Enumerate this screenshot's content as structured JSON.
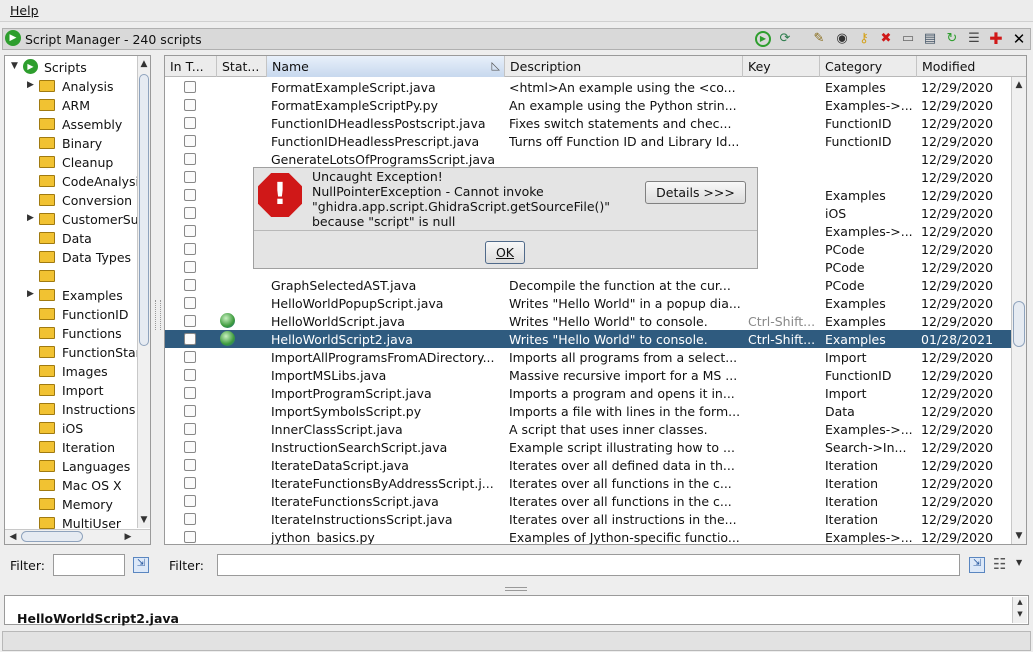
{
  "menu": {
    "help": "Help"
  },
  "title": "Script Manager - 240 scripts",
  "tree": {
    "root": "Scripts",
    "items": [
      {
        "label": "Analysis",
        "expandable": true
      },
      {
        "label": "ARM",
        "expandable": false
      },
      {
        "label": "Assembly",
        "expandable": false
      },
      {
        "label": "Binary",
        "expandable": false
      },
      {
        "label": "Cleanup",
        "expandable": false
      },
      {
        "label": "CodeAnalysis",
        "expandable": false
      },
      {
        "label": "Conversion",
        "expandable": false
      },
      {
        "label": "CustomerSubmission",
        "expandable": true
      },
      {
        "label": "Data",
        "expandable": false
      },
      {
        "label": "Data Types",
        "expandable": false
      },
      {
        "label": "",
        "expandable": false
      },
      {
        "label": "Examples",
        "expandable": true
      },
      {
        "label": "FunctionID",
        "expandable": false
      },
      {
        "label": "Functions",
        "expandable": false
      },
      {
        "label": "FunctionStartPatterns",
        "expandable": false
      },
      {
        "label": "Images",
        "expandable": false
      },
      {
        "label": "Import",
        "expandable": false
      },
      {
        "label": "Instructions",
        "expandable": false
      },
      {
        "label": "iOS",
        "expandable": false
      },
      {
        "label": "Iteration",
        "expandable": false
      },
      {
        "label": "Languages",
        "expandable": false
      },
      {
        "label": "Mac OS X",
        "expandable": false
      },
      {
        "label": "Memory",
        "expandable": false
      },
      {
        "label": "MultiUser",
        "expandable": false
      }
    ]
  },
  "filter_label": "Filter:",
  "columns": [
    "In T...",
    "Stat...",
    "Name",
    "Description",
    "Key",
    "Category",
    "Modified"
  ],
  "rows": [
    {
      "name": "FormatExampleScript.java",
      "desc": "<html>An example using the <co...",
      "key": "",
      "cat": "Examples",
      "mod": "12/29/2020",
      "status": "",
      "selected": false
    },
    {
      "name": "FormatExampleScriptPy.py",
      "desc": "An example using the Python strin...",
      "key": "",
      "cat": "Examples->...",
      "mod": "12/29/2020",
      "status": "",
      "selected": false
    },
    {
      "name": "FunctionIDHeadlessPostscript.java",
      "desc": "Fixes switch statements and chec...",
      "key": "",
      "cat": "FunctionID",
      "mod": "12/29/2020",
      "status": "",
      "selected": false
    },
    {
      "name": "FunctionIDHeadlessPrescript.java",
      "desc": "Turns off Function ID and Library Id...",
      "key": "",
      "cat": "FunctionID",
      "mod": "12/29/2020",
      "status": "",
      "selected": false
    },
    {
      "name": "GenerateLotsOfProgramsScript.java",
      "desc": "",
      "key": "",
      "cat": "",
      "mod": "12/29/2020",
      "status": "",
      "selected": false
    },
    {
      "name": "",
      "desc": "",
      "key": "",
      "cat": "",
      "mod": "12/29/2020",
      "status": "",
      "selected": false
    },
    {
      "name": "",
      "desc": "",
      "key": "",
      "cat": "Examples",
      "mod": "12/29/2020",
      "status": "",
      "selected": false
    },
    {
      "name": "",
      "desc": "",
      "key": "",
      "cat": "iOS",
      "mod": "12/29/2020",
      "status": "",
      "selected": false
    },
    {
      "name": "",
      "desc": "",
      "key": "",
      "cat": "Examples->...",
      "mod": "12/29/2020",
      "status": "",
      "selected": false
    },
    {
      "name": "",
      "desc": "",
      "key": "",
      "cat": "PCode",
      "mod": "12/29/2020",
      "status": "",
      "selected": false
    },
    {
      "name": "",
      "desc": "",
      "key": "",
      "cat": "PCode",
      "mod": "12/29/2020",
      "status": "",
      "selected": false
    },
    {
      "name": "GraphSelectedAST.java",
      "desc": "Decompile the function at the cur...",
      "key": "",
      "cat": "PCode",
      "mod": "12/29/2020",
      "status": "",
      "selected": false
    },
    {
      "name": "HelloWorldPopupScript.java",
      "desc": "Writes \"Hello World\" in a popup dia...",
      "key": "",
      "cat": "Examples",
      "mod": "12/29/2020",
      "status": "",
      "selected": false
    },
    {
      "name": "HelloWorldScript.java",
      "desc": "Writes \"Hello World\" to console.",
      "key": "Ctrl-Shift...",
      "cat": "Examples",
      "mod": "12/29/2020",
      "status": "globe",
      "selected": false
    },
    {
      "name": "HelloWorldScript2.java",
      "desc": "Writes \"Hello World\" to console.",
      "key": "Ctrl-Shift...",
      "cat": "Examples",
      "mod": "01/28/2021",
      "status": "globe",
      "selected": true
    },
    {
      "name": "ImportAllProgramsFromADirectory...",
      "desc": "Imports all programs from a select...",
      "key": "",
      "cat": "Import",
      "mod": "12/29/2020",
      "status": "",
      "selected": false
    },
    {
      "name": "ImportMSLibs.java",
      "desc": "Massive recursive import for a MS ...",
      "key": "",
      "cat": "FunctionID",
      "mod": "12/29/2020",
      "status": "",
      "selected": false
    },
    {
      "name": "ImportProgramScript.java",
      "desc": "Imports a program and opens it in...",
      "key": "",
      "cat": "Import",
      "mod": "12/29/2020",
      "status": "",
      "selected": false
    },
    {
      "name": "ImportSymbolsScript.py",
      "desc": "Imports a file with lines in the form...",
      "key": "",
      "cat": "Data",
      "mod": "12/29/2020",
      "status": "",
      "selected": false
    },
    {
      "name": "InnerClassScript.java",
      "desc": "A script that uses inner classes.",
      "key": "",
      "cat": "Examples->...",
      "mod": "12/29/2020",
      "status": "",
      "selected": false
    },
    {
      "name": "InstructionSearchScript.java",
      "desc": " Example script illustrating how to ...",
      "key": "",
      "cat": "Search->In...",
      "mod": "12/29/2020",
      "status": "",
      "selected": false
    },
    {
      "name": "IterateDataScript.java",
      "desc": "Iterates over all defined data in th...",
      "key": "",
      "cat": "Iteration",
      "mod": "12/29/2020",
      "status": "",
      "selected": false
    },
    {
      "name": "IterateFunctionsByAddressScript.j...",
      "desc": "Iterates over all functions in the c...",
      "key": "",
      "cat": "Iteration",
      "mod": "12/29/2020",
      "status": "",
      "selected": false
    },
    {
      "name": "IterateFunctionsScript.java",
      "desc": "Iterates over all functions in the c...",
      "key": "",
      "cat": "Iteration",
      "mod": "12/29/2020",
      "status": "",
      "selected": false
    },
    {
      "name": "IterateInstructionsScript.java",
      "desc": "Iterates over all instructions in the...",
      "key": "",
      "cat": "Iteration",
      "mod": "12/29/2020",
      "status": "",
      "selected": false
    },
    {
      "name": "jython_basics.py",
      "desc": "Examples of Jython-specific functio...",
      "key": "",
      "cat": "Examples->...",
      "mod": "12/29/2020",
      "status": "",
      "selected": false
    }
  ],
  "dialog": {
    "line1": "Uncaught Exception!",
    "line2": "NullPointerException - Cannot invoke",
    "line3": "\"ghidra.app.script.GhidraScript.getSourceFile()\"",
    "line4": "because \"script\" is null",
    "details": "Details >>>",
    "ok": "OK"
  },
  "bottom_text": "HelloWorldScript2.java"
}
